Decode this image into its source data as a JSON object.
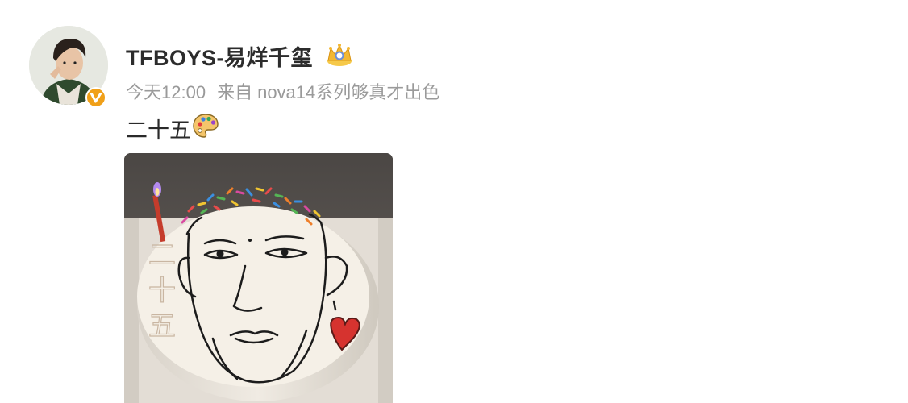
{
  "post": {
    "username": "TFBOYS-易烊千玺",
    "time": "今天12:00",
    "source_label": "来自",
    "source_device": "nova14系列够真才出色",
    "content": "二十五",
    "cake_text": [
      "二",
      "十",
      "五"
    ]
  },
  "icons": {
    "avatar": "user-avatar",
    "verified": "verified-v-badge",
    "crown": "crown-icon",
    "palette": "artist-palette-emoji"
  },
  "colors": {
    "text_primary": "#2c2c2c",
    "text_meta": "#9a9a9a",
    "badge_orange": "#f0a019",
    "background": "#ffffff"
  }
}
